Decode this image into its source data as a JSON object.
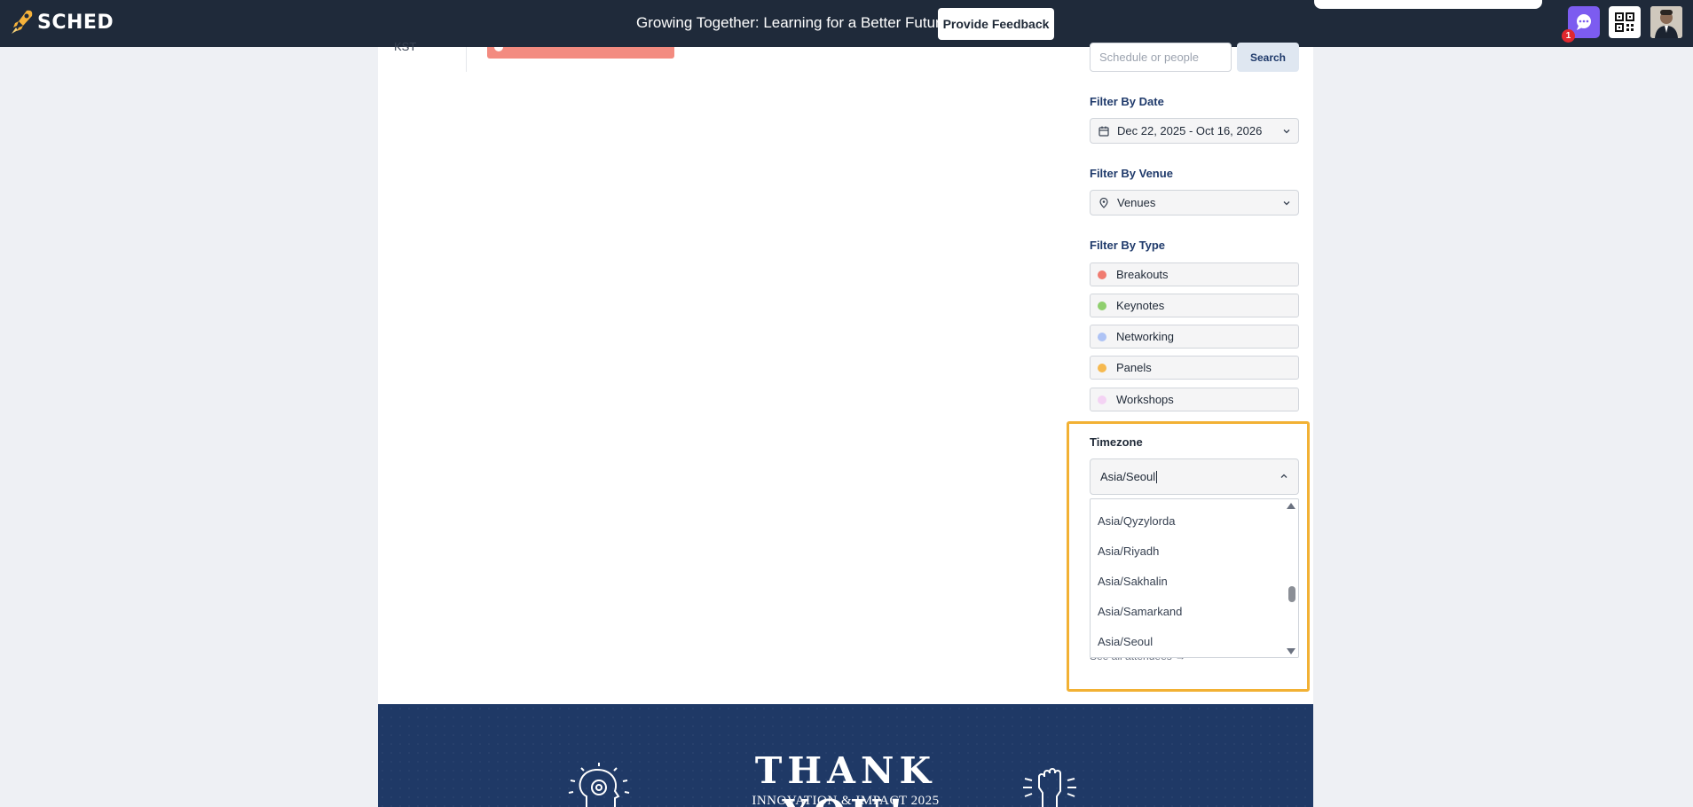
{
  "app": {
    "name": "SCHED",
    "event_title": "Growing Together: Learning for a Better Future",
    "feedback_label": "Provide Feedback",
    "notification_count": "1"
  },
  "schedule": {
    "time_label": "KST",
    "session_color": "#f38b80"
  },
  "sidebar": {
    "search": {
      "placeholder": "Schedule or people",
      "button_label": "Search"
    },
    "filter_date": {
      "label": "Filter By Date",
      "value": "Dec 22, 2025 - Oct 16, 2026"
    },
    "filter_venue": {
      "label": "Filter By Venue",
      "value": "Venues"
    },
    "filter_type": {
      "label": "Filter By Type",
      "items": [
        {
          "label": "Breakouts",
          "color": "#f07b70"
        },
        {
          "label": "Keynotes",
          "color": "#8fcf6e"
        },
        {
          "label": "Networking",
          "color": "#aec3f5"
        },
        {
          "label": "Panels",
          "color": "#f6b94f"
        },
        {
          "label": "Workshops",
          "color": "#f4d3f4"
        }
      ]
    },
    "timezone": {
      "label": "Timezone",
      "value": "Asia/Seoul",
      "options": [
        "Asia/Qyzylorda",
        "Asia/Riyadh",
        "Asia/Sakhalin",
        "Asia/Samarkand",
        "Asia/Seoul"
      ],
      "see_all_label": "See all attendees →"
    }
  },
  "banner": {
    "title": "THANK YOU!",
    "subtitle": "INNOVATION & IMPACT 2025"
  },
  "colors": {
    "topbar": "#1f2a3a",
    "highlight": "#f2b134",
    "banner": "#1f3966",
    "chat": "#7c5cf0"
  }
}
